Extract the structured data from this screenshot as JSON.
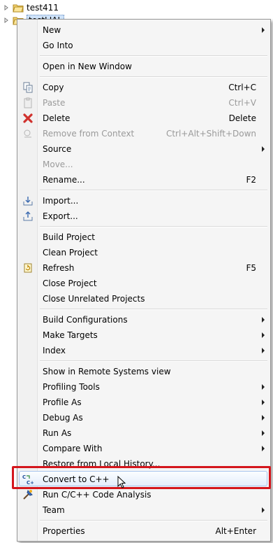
{
  "tree": [
    {
      "label": "test411"
    },
    {
      "label": "testLIAL"
    }
  ],
  "menu": {
    "items": [
      {
        "label": "New",
        "shortcut": "",
        "submenu": true
      },
      {
        "label": "Go Into",
        "shortcut": ""
      },
      {
        "label": "Open in New Window",
        "shortcut": ""
      },
      {
        "label": "Copy",
        "shortcut": "Ctrl+C"
      },
      {
        "label": "Paste",
        "shortcut": "Ctrl+V"
      },
      {
        "label": "Delete",
        "shortcut": "Delete"
      },
      {
        "label": "Remove from Context",
        "shortcut": "Ctrl+Alt+Shift+Down"
      },
      {
        "label": "Source",
        "shortcut": "",
        "submenu": true
      },
      {
        "label": "Move...",
        "shortcut": ""
      },
      {
        "label": "Rename...",
        "shortcut": "F2"
      },
      {
        "label": "Import...",
        "shortcut": ""
      },
      {
        "label": "Export...",
        "shortcut": ""
      },
      {
        "label": "Build Project",
        "shortcut": ""
      },
      {
        "label": "Clean Project",
        "shortcut": ""
      },
      {
        "label": "Refresh",
        "shortcut": "F5"
      },
      {
        "label": "Close Project",
        "shortcut": ""
      },
      {
        "label": "Close Unrelated Projects",
        "shortcut": ""
      },
      {
        "label": "Build Configurations",
        "shortcut": "",
        "submenu": true
      },
      {
        "label": "Make Targets",
        "shortcut": "",
        "submenu": true
      },
      {
        "label": "Index",
        "shortcut": "",
        "submenu": true
      },
      {
        "label": "Show in Remote Systems view",
        "shortcut": ""
      },
      {
        "label": "Profiling Tools",
        "shortcut": "",
        "submenu": true
      },
      {
        "label": "Profile As",
        "shortcut": "",
        "submenu": true
      },
      {
        "label": "Debug As",
        "shortcut": "",
        "submenu": true
      },
      {
        "label": "Run As",
        "shortcut": "",
        "submenu": true
      },
      {
        "label": "Compare With",
        "shortcut": "",
        "submenu": true
      },
      {
        "label": "Restore from Local History...",
        "shortcut": ""
      },
      {
        "label": "Convert to C++",
        "shortcut": ""
      },
      {
        "label": "Run C/C++ Code Analysis",
        "shortcut": ""
      },
      {
        "label": "Team",
        "shortcut": "",
        "submenu": true
      },
      {
        "label": "Properties",
        "shortcut": "Alt+Enter"
      }
    ]
  },
  "colors": {
    "highlight_border": "#d4161c",
    "disabled_text": "#9a9a9a"
  }
}
